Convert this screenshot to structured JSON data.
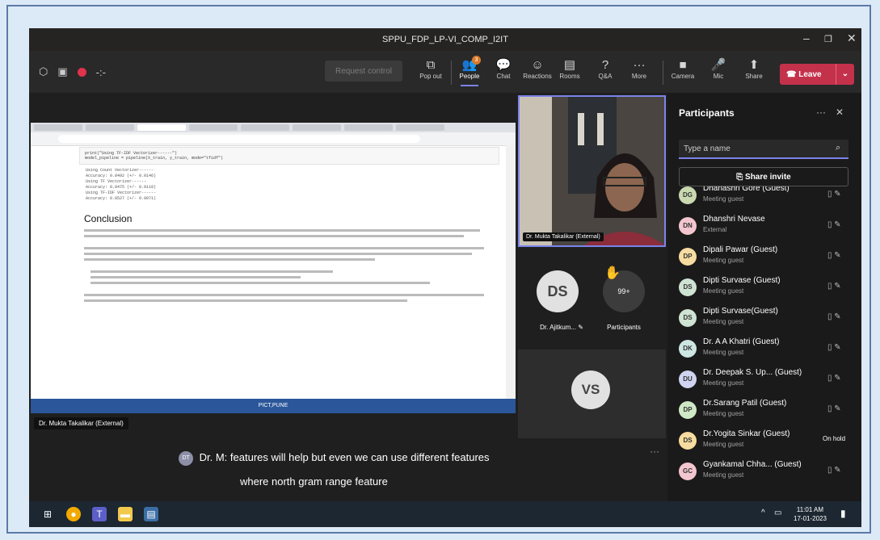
{
  "window": {
    "title": "SPPU_FDP_LP-VI_COMP_I2IT"
  },
  "toolbar": {
    "request_control": "Request control",
    "tools": [
      {
        "icon": "pop-out-icon",
        "label": "Pop out"
      },
      {
        "icon": "people-icon",
        "label": "People",
        "badge": "3"
      },
      {
        "icon": "chat-icon",
        "label": "Chat"
      },
      {
        "icon": "reactions-icon",
        "label": "Reactions"
      },
      {
        "icon": "rooms-icon",
        "label": "Rooms"
      },
      {
        "icon": "qa-icon",
        "label": "Q&A"
      },
      {
        "icon": "more-icon",
        "label": "More"
      },
      {
        "icon": "camera-icon",
        "label": "Camera"
      },
      {
        "icon": "mic-icon",
        "label": "Mic"
      },
      {
        "icon": "share-icon",
        "label": "Share"
      }
    ],
    "leave": "Leave"
  },
  "share": {
    "doc_heading": "Conclusion",
    "status_text": "PICT,PUNE",
    "code": [
      "print(\"Using TF-IDF Vectorizer------\")",
      "model_pipeline = pipeline(X_train, y_train, mode=\"tfidf\")"
    ],
    "outputs": [
      "Using Count Vectorizer------",
      "Accuracy: 0.8492 (+/- 0.0146)",
      "Using TF Vectorizer------",
      "Accuracy: 0.8475 (+/- 0.0118)",
      "Using TF-IDF Vectorizer------",
      "Accuracy: 0.8527 (+/- 0.0071)"
    ]
  },
  "presenter_chip": "Dr. Mukta Takalikar (External)",
  "caption": {
    "speaker_initials": "DT",
    "speaker": "Dr. M:",
    "line1": "features will help but even we can use different features",
    "line2": "where north gram range feature"
  },
  "video": {
    "main_label": "Dr. Mukta Takalikar (External)",
    "ds_initials": "DS",
    "ds_label": "Dr. Ajitkum...",
    "participants_count": "99+",
    "participants_label": "Participants",
    "vs_initials": "VS"
  },
  "panel": {
    "title": "Participants",
    "search_placeholder": "Type a name",
    "invite": "Share invite",
    "people": [
      {
        "initials": "DG",
        "name": "Dhanashri Gore (Guest)",
        "role": "Meeting guest",
        "color": "#c9d9b0"
      },
      {
        "initials": "DN",
        "name": "Dhanshri Nevase",
        "role": "External",
        "color": "#f3c6cf"
      },
      {
        "initials": "DP",
        "name": "Dipali Pawar (Guest)",
        "role": "Meeting guest",
        "color": "#f6dca0"
      },
      {
        "initials": "DS",
        "name": "Dipti Survase (Guest)",
        "role": "Meeting guest",
        "color": "#cfe3d2"
      },
      {
        "initials": "DS",
        "name": "Dipti Survase(Guest)",
        "role": "Meeting guest",
        "color": "#cfe3d2"
      },
      {
        "initials": "DK",
        "name": "Dr. A A Khatri (Guest)",
        "role": "Meeting guest",
        "color": "#cde6e2"
      },
      {
        "initials": "DU",
        "name": "Dr. Deepak S. Up... (Guest)",
        "role": "Meeting guest",
        "color": "#cfd4f0"
      },
      {
        "initials": "DP",
        "name": "Dr.Sarang Patil (Guest)",
        "role": "Meeting guest",
        "color": "#cfe8c5"
      },
      {
        "initials": "DS",
        "name": "Dr.Yogita Sinkar (Guest)",
        "role": "Meeting guest",
        "color": "#f6dca0",
        "status": "On hold"
      },
      {
        "initials": "GC",
        "name": "Gyankamal Chha... (Guest)",
        "role": "Meeting guest",
        "color": "#f3c6cf"
      }
    ]
  },
  "taskbar": {
    "time": "11:01 AM",
    "date": "17-01-2023"
  }
}
